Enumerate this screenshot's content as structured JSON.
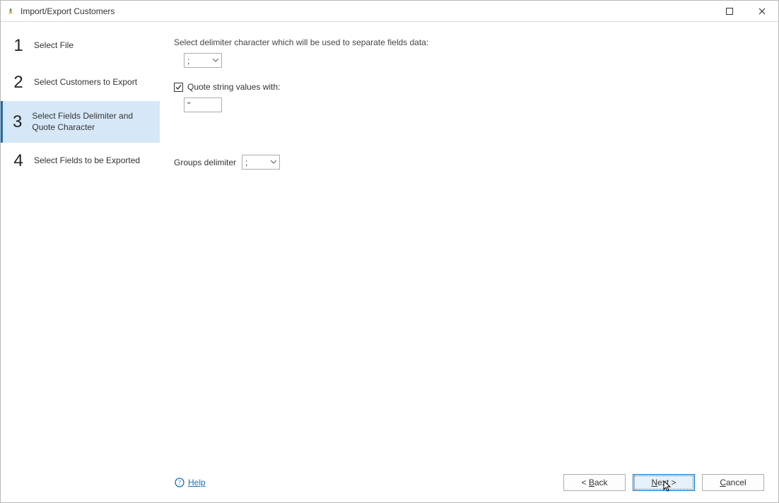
{
  "window": {
    "title": "Import/Export Customers"
  },
  "sidebar": {
    "steps": [
      {
        "num": "1",
        "label": "Select File"
      },
      {
        "num": "2",
        "label": "Select Customers to Export"
      },
      {
        "num": "3",
        "label": "Select Fields Delimiter and Quote Character"
      },
      {
        "num": "4",
        "label": "Select Fields to be Exported"
      }
    ],
    "active_index": 2
  },
  "main": {
    "delimiter_instruction": "Select delimiter character which will be used to separate fields data:",
    "delimiter_value": ";",
    "quote_checkbox_label": "Quote string values with:",
    "quote_checked": true,
    "quote_value": "\"",
    "groups_label": "Groups delimiter",
    "groups_value": ";"
  },
  "footer": {
    "help": "Help",
    "back": "< Back",
    "next": "Next >",
    "cancel": "Cancel"
  }
}
